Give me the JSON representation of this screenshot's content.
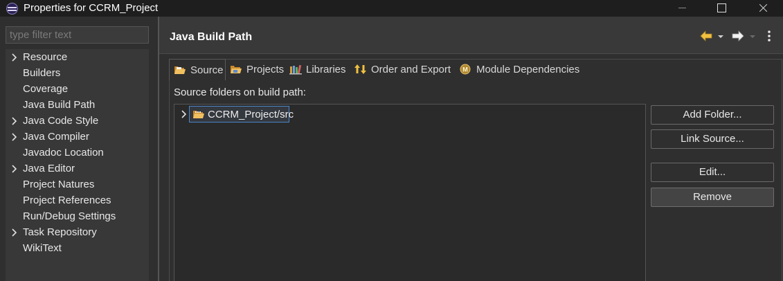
{
  "window": {
    "title": "Properties for CCRM_Project",
    "app_icon": "eclipse-icon",
    "controls": [
      "minimize-icon",
      "maximize-icon",
      "close-icon"
    ]
  },
  "sidebar": {
    "filter_placeholder": "type filter text",
    "items": [
      {
        "label": "Resource",
        "expandable": true
      },
      {
        "label": "Builders",
        "expandable": false
      },
      {
        "label": "Coverage",
        "expandable": false
      },
      {
        "label": "Java Build Path",
        "expandable": false
      },
      {
        "label": "Java Code Style",
        "expandable": true
      },
      {
        "label": "Java Compiler",
        "expandable": true
      },
      {
        "label": "Javadoc Location",
        "expandable": false
      },
      {
        "label": "Java Editor",
        "expandable": true
      },
      {
        "label": "Project Natures",
        "expandable": false
      },
      {
        "label": "Project References",
        "expandable": false
      },
      {
        "label": "Run/Debug Settings",
        "expandable": false
      },
      {
        "label": "Task Repository",
        "expandable": true
      },
      {
        "label": "WikiText",
        "expandable": false
      }
    ]
  },
  "page": {
    "title": "Java Build Path",
    "header_icons": [
      "back-arrow-icon",
      "dropdown-icon",
      "forward-arrow-icon",
      "dropdown-icon",
      "more-vertical-icon"
    ]
  },
  "tabs": [
    {
      "label": "Source",
      "mnemonic_index": 0,
      "icon": "source-folder-icon",
      "active": true
    },
    {
      "label": "Projects",
      "mnemonic_index": 0,
      "icon": "projects-icon",
      "active": false
    },
    {
      "label": "Libraries",
      "mnemonic_index": 0,
      "icon": "libraries-icon",
      "active": false
    },
    {
      "label": "Order and Export",
      "mnemonic_index": 0,
      "icon": "order-export-icon",
      "active": false
    },
    {
      "label": "Module Dependencies",
      "mnemonic_index": 0,
      "icon": "module-icon",
      "active": false
    }
  ],
  "source_tab": {
    "section_label": "Source folders on build path:",
    "folders": [
      {
        "label": "CCRM_Project/src",
        "selected": true,
        "icon": "package-folder-icon"
      }
    ],
    "buttons": {
      "add_folder": "Add Folder...",
      "link_source": "Link Source...",
      "edit": "Edit...",
      "remove": "Remove"
    }
  },
  "colors": {
    "background": "#2f2f2f",
    "titlebar": "#1e1e1e",
    "selection_border": "#4d86c8",
    "folder_icon": "#e8b04a"
  }
}
